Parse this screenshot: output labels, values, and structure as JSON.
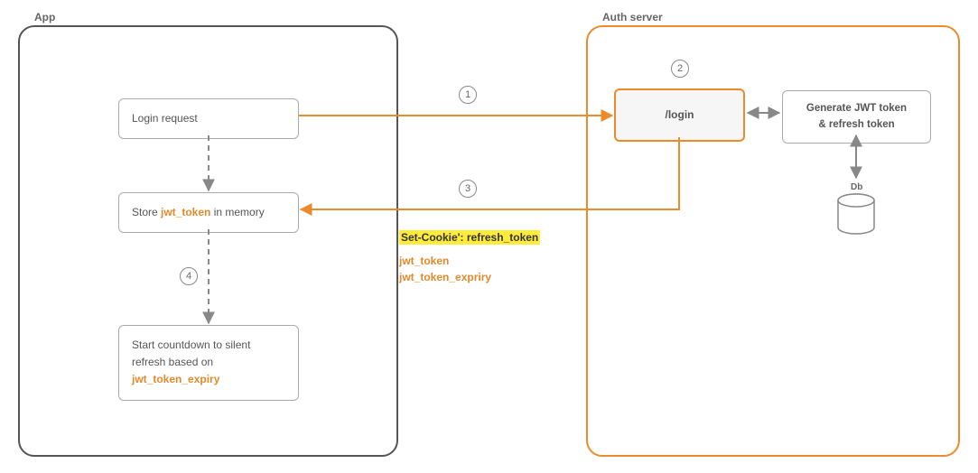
{
  "frames": {
    "app": {
      "title": "App"
    },
    "auth": {
      "title": "Auth server"
    }
  },
  "nodes": {
    "login_request": "Login request",
    "store_pre": "Store ",
    "store_token": "jwt_token",
    "store_post": " in memory",
    "countdown_l1": "Start countdown to silent",
    "countdown_l2": "refresh based on",
    "countdown_token": "jwt_token_expiry",
    "login_endpoint": "/login",
    "generate_l1": "Generate JWT token",
    "generate_l2": "& refresh token",
    "db": "Db"
  },
  "edge_labels": {
    "cookie_pre": "Set-Cookie': ",
    "cookie_token": "refresh_token",
    "body_l1": "jwt_token",
    "body_l2": "jwt_token_expriry"
  },
  "steps": {
    "s1": "1",
    "s2": "2",
    "s3": "3",
    "s4": "4"
  },
  "colors": {
    "orange": "#ec8b2e",
    "gray": "#888"
  }
}
